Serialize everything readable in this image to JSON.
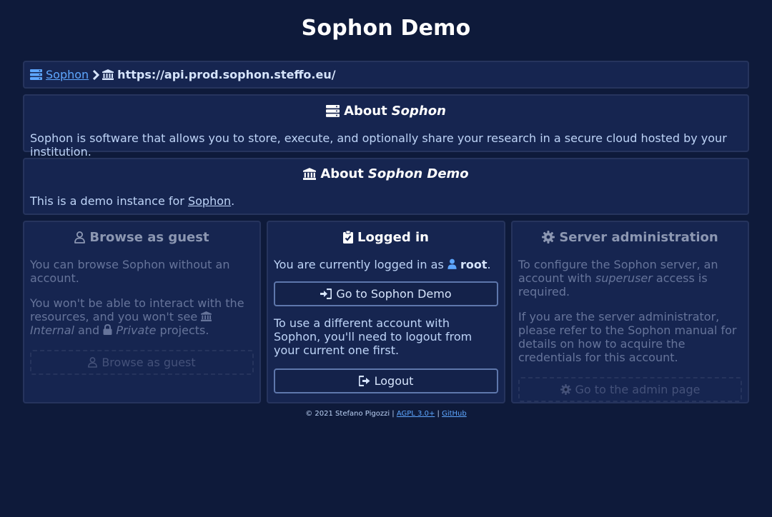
{
  "page": {
    "title": "Sophon Demo"
  },
  "breadcrumb": {
    "root_label": "Sophon",
    "current_label": "https://api.prod.sophon.steffo.eu/"
  },
  "about_sophon": {
    "heading_prefix": "About",
    "heading_emph": "Sophon",
    "text": "Sophon is software that allows you to store, execute, and optionally share your research in a secure cloud hosted by your institution."
  },
  "about_instance": {
    "heading_prefix": "About",
    "heading_emph": "Sophon Demo",
    "text_prefix": "This is a demo instance for",
    "link_label": "Sophon",
    "text_suffix": "."
  },
  "guest": {
    "heading": "Browse as guest",
    "p1": "You can browse Sophon without an account.",
    "p2_prefix": "You won't be able to interact with the resources, and you won't see",
    "internal_label": "Internal",
    "and_label": "and",
    "private_label": "Private",
    "p2_suffix": "projects.",
    "button_label": "Browse as guest"
  },
  "logged_in": {
    "heading": "Logged in",
    "p1_prefix": "You are currently logged in as",
    "username": "root",
    "p1_suffix": ".",
    "go_button_label": "Go to Sophon Demo",
    "p2": "To use a different account with Sophon, you'll need to logout from your current one first.",
    "logout_button_label": "Logout"
  },
  "admin": {
    "heading": "Server administration",
    "p1_prefix": "To configure the Sophon server, an account with",
    "p1_emph": "superuser",
    "p1_suffix": "access is required.",
    "p2": "If you are the server administrator, please refer to the Sophon manual for details on how to acquire the credentials for this account.",
    "button_label": "Go to the admin page"
  },
  "footer": {
    "copyright": "© 2021 Stefano Pigozzi",
    "sep1": "|",
    "license_label": "AGPL 3.0+",
    "sep2": "|",
    "github_label": "GitHub"
  },
  "colors": {
    "background": "#0e1a3a",
    "panel": "#162550",
    "panel_border": "#26345d",
    "text": "#bed4f7",
    "link": "#5ea7ff",
    "heading": "#ffffff",
    "dim_text": "#66749a"
  },
  "icons": {
    "breadcrumb_root": "server-icon",
    "breadcrumb_sep": "chevron-right-icon",
    "breadcrumb_current": "university-icon",
    "guest": "user-outline-icon",
    "logged_in": "clipboard-check-icon",
    "admin": "cog-icon",
    "go": "sign-in-icon",
    "logout": "sign-out-icon"
  }
}
